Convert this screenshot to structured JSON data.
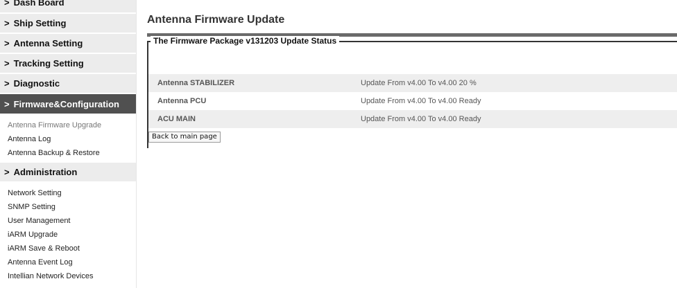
{
  "sidebar": {
    "dash_board": "Dash Board",
    "ship_setting": "Ship Setting",
    "antenna_setting": "Antenna Setting",
    "tracking_setting": "Tracking Setting",
    "diagnostic": "Diagnostic",
    "firmware_config": {
      "label": "Firmware&Configuration",
      "items": [
        "Antenna Firmware Upgrade",
        "Antenna Log",
        "Antenna Backup & Restore"
      ]
    },
    "administration": {
      "label": "Administration",
      "items": [
        "Network Setting",
        "SNMP Setting",
        "User Management",
        "iARM Upgrade",
        "iARM Save & Reboot",
        "Antenna Event Log",
        "Intellian Network Devices"
      ]
    },
    "chevron": ">"
  },
  "main": {
    "title": "Antenna Firmware Update",
    "legend": "The Firmware Package v131203 Update Status",
    "rows": [
      {
        "name": "Antenna STABILIZER",
        "status": "Update From v4.00 To v4.00 20 %"
      },
      {
        "name": "Antenna PCU",
        "status": "Update From v4.00 To v4.00 Ready"
      },
      {
        "name": "ACU MAIN",
        "status": "Update From v4.00 To v4.00 Ready"
      }
    ],
    "back_button": "Back to main page"
  }
}
